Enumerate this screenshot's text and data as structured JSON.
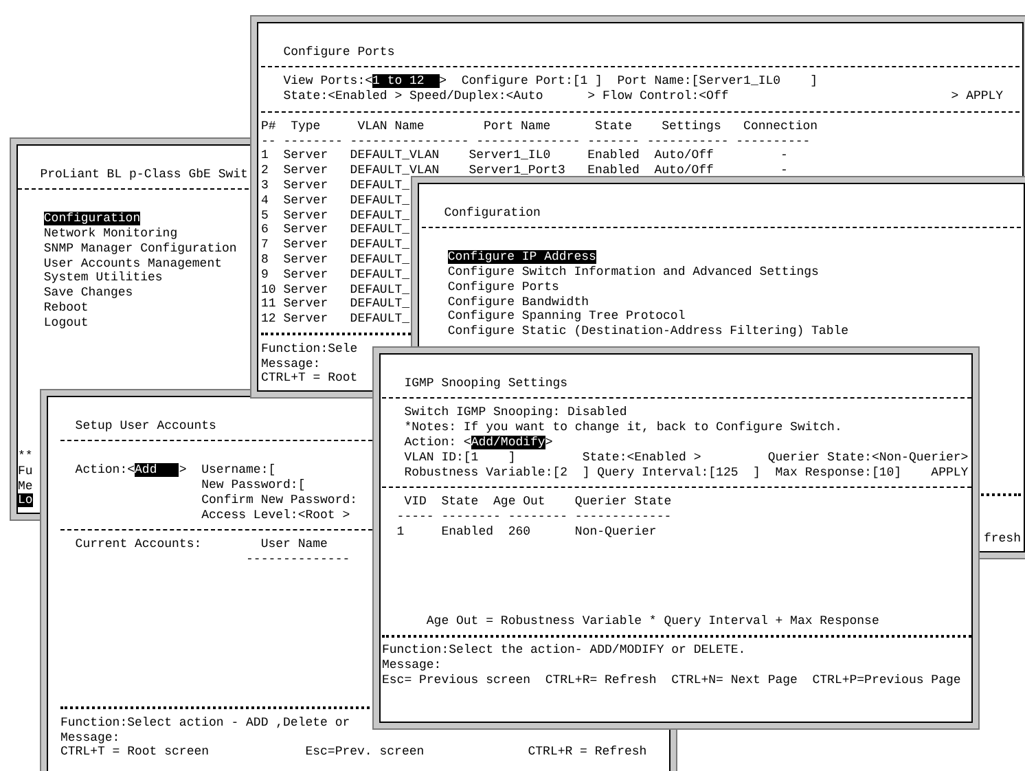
{
  "windows": [
    {
      "lines": [
        {
          "kind": "blank"
        },
        {
          "kind": "text",
          "segments": [
            {
              "text": "   Configure Ports"
            }
          ]
        },
        {
          "kind": "dash_rule"
        },
        {
          "kind": "text",
          "segments": [
            {
              "text": "   View Ports:<"
            },
            {
              "text": "1 to 12  ",
              "selected": true
            },
            {
              "text": ">  Configure Port:[1 ]  Port Name:[Server1_IL0    ]"
            }
          ]
        },
        {
          "kind": "text",
          "segments": [
            {
              "text": "   State:<Enabled > Speed/Duplex:<Auto      > Flow Control:<Off                              > APPLY"
            }
          ]
        },
        {
          "kind": "dash_rule"
        },
        {
          "kind": "text",
          "segments": [
            {
              "text": "P#  Type     VLAN Name        Port Name      State    Settings   Connection"
            }
          ]
        },
        {
          "kind": "text",
          "segments": [
            {
              "text": "-- -------- ---------------- -------------- ------- ----------- ----------"
            }
          ]
        },
        {
          "kind": "text",
          "segments": [
            {
              "text": "1  Server   DEFAULT_VLAN    Server1_IL0     Enabled  Auto/Off         -"
            }
          ]
        },
        {
          "kind": "text",
          "segments": [
            {
              "text": "2  Server   DEFAULT_VLAN    Server1_Port3   Enabled  Auto/Off         -"
            }
          ]
        },
        {
          "kind": "text",
          "segments": [
            {
              "text": "3  Server   DEFAULT_"
            }
          ]
        },
        {
          "kind": "text",
          "segments": [
            {
              "text": "4  Server   DEFAULT_"
            }
          ]
        },
        {
          "kind": "text",
          "segments": [
            {
              "text": "5  Server   DEFAULT_"
            }
          ]
        },
        {
          "kind": "text",
          "segments": [
            {
              "text": "6  Server   DEFAULT_"
            }
          ]
        },
        {
          "kind": "text",
          "segments": [
            {
              "text": "7  Server   DEFAULT_"
            }
          ]
        },
        {
          "kind": "text",
          "segments": [
            {
              "text": "8  Server   DEFAULT_"
            }
          ]
        },
        {
          "kind": "text",
          "segments": [
            {
              "text": "9  Server   DEFAULT_"
            }
          ]
        },
        {
          "kind": "text",
          "segments": [
            {
              "text": "10 Server   DEFAULT_"
            }
          ]
        },
        {
          "kind": "text",
          "segments": [
            {
              "text": "11 Server   DEFAULT_"
            }
          ]
        },
        {
          "kind": "text",
          "segments": [
            {
              "text": "12 Server   DEFAULT_"
            }
          ]
        },
        {
          "kind": "star_rule"
        },
        {
          "kind": "text",
          "segments": [
            {
              "text": "Function:Sele"
            }
          ]
        },
        {
          "kind": "text",
          "segments": [
            {
              "text": "Message:"
            }
          ]
        },
        {
          "kind": "text",
          "segments": [
            {
              "text": "CTRL+T = Root"
            }
          ]
        }
      ]
    },
    {
      "lines": [
        {
          "kind": "blank"
        },
        {
          "kind": "text",
          "segments": [
            {
              "text": "   ProLiant BL p-Class GbE Swit"
            }
          ]
        },
        {
          "kind": "dash_rule"
        },
        {
          "kind": "blank"
        },
        {
          "kind": "menu",
          "text": "Configuration",
          "selected": true
        },
        {
          "kind": "menu",
          "text": "Network Monitoring",
          "selected": false
        },
        {
          "kind": "menu",
          "text": "SNMP Manager Configuration",
          "selected": false
        },
        {
          "kind": "menu",
          "text": "User Accounts Management",
          "selected": false
        },
        {
          "kind": "menu",
          "text": "System Utilities",
          "selected": false
        },
        {
          "kind": "menu",
          "text": "Save Changes",
          "selected": false
        },
        {
          "kind": "menu",
          "text": "Reboot",
          "selected": false
        },
        {
          "kind": "menu",
          "text": "Logout",
          "selected": false
        },
        {
          "kind": "blank"
        },
        {
          "kind": "blank"
        },
        {
          "kind": "blank"
        },
        {
          "kind": "blank"
        },
        {
          "kind": "blank"
        },
        {
          "kind": "blank"
        },
        {
          "kind": "blank"
        },
        {
          "kind": "blank"
        },
        {
          "kind": "text",
          "segments": [
            {
              "text": "**"
            }
          ]
        },
        {
          "kind": "text",
          "segments": [
            {
              "text": "Fu"
            }
          ]
        },
        {
          "kind": "text",
          "segments": [
            {
              "text": "Me"
            }
          ]
        },
        {
          "kind": "text",
          "segments": [
            {
              "text": "Lo",
              "selected": true
            }
          ]
        }
      ]
    },
    {
      "lines": [
        {
          "kind": "blank"
        },
        {
          "kind": "text",
          "segments": [
            {
              "text": "   Configuration"
            }
          ]
        },
        {
          "kind": "dash_rule"
        },
        {
          "kind": "blank"
        },
        {
          "kind": "menu",
          "text": "Configure IP Address",
          "selected": true
        },
        {
          "kind": "menu",
          "text": "Configure Switch Information and Advanced Settings",
          "selected": false
        },
        {
          "kind": "menu",
          "text": "Configure Ports",
          "selected": false
        },
        {
          "kind": "menu",
          "text": "Configure Bandwidth",
          "selected": false
        },
        {
          "kind": "menu",
          "text": "Configure Spanning Tree Protocol",
          "selected": false
        },
        {
          "kind": "menu",
          "text": "Configure Static (Destination-Address Filtering) Table",
          "selected": false
        },
        {
          "kind": "blank"
        },
        {
          "kind": "blank"
        },
        {
          "kind": "blank"
        },
        {
          "kind": "blank"
        },
        {
          "kind": "blank"
        },
        {
          "kind": "blank"
        },
        {
          "kind": "blank"
        },
        {
          "kind": "blank"
        },
        {
          "kind": "blank"
        },
        {
          "kind": "blank"
        },
        {
          "kind": "star_rule"
        },
        {
          "kind": "blank"
        },
        {
          "kind": "blank"
        },
        {
          "kind": "tail",
          "text": "fresh"
        }
      ]
    },
    {
      "lines": [
        {
          "kind": "blank"
        },
        {
          "kind": "text",
          "segments": [
            {
              "text": "   IGMP Snooping Settings"
            }
          ]
        },
        {
          "kind": "dash_rule"
        },
        {
          "kind": "text",
          "segments": [
            {
              "text": "   Switch IGMP Snooping: Disabled"
            }
          ]
        },
        {
          "kind": "text",
          "segments": [
            {
              "text": "   *Notes: If you want to change it, back to Configure Switch."
            }
          ]
        },
        {
          "kind": "text",
          "segments": [
            {
              "text": "   Action: <"
            },
            {
              "text": "Add/Modify",
              "selected": true
            },
            {
              "text": ">"
            }
          ]
        },
        {
          "kind": "text",
          "segments": [
            {
              "text": "   VLAN ID:[1    ]         State:<Enabled >         Querier State:<Non-Querier>"
            }
          ]
        },
        {
          "kind": "text",
          "segments": [
            {
              "text": "   Robustness Variable:[2  ] Query Interval:[125  ]  Max Response:[10]    APPLY"
            }
          ]
        },
        {
          "kind": "dash_rule"
        },
        {
          "kind": "text",
          "segments": [
            {
              "text": "   VID  State  Age Out    Querier State"
            }
          ]
        },
        {
          "kind": "text",
          "segments": [
            {
              "text": "  ----- -------- -------- -------------"
            }
          ]
        },
        {
          "kind": "text",
          "segments": [
            {
              "text": "  1     Enabled  260      Non-Querier"
            }
          ]
        },
        {
          "kind": "blank"
        },
        {
          "kind": "blank"
        },
        {
          "kind": "blank"
        },
        {
          "kind": "blank"
        },
        {
          "kind": "blank"
        },
        {
          "kind": "text",
          "segments": [
            {
              "text": "      Age Out = Robustness Variable * Query Interval + Max Response"
            }
          ]
        },
        {
          "kind": "star_rule"
        },
        {
          "kind": "text",
          "segments": [
            {
              "text": "Function:Select the action- ADD/MODIFY or DELETE."
            }
          ]
        },
        {
          "kind": "text",
          "segments": [
            {
              "text": "Message:"
            }
          ]
        },
        {
          "kind": "text",
          "segments": [
            {
              "text": "Esc= Previous screen  CTRL+R= Refresh  CTRL+N= Next Page  CTRL+P=Previous Page"
            }
          ]
        },
        {
          "kind": "blank"
        },
        {
          "kind": "blank"
        }
      ]
    },
    {
      "lines": [
        {
          "kind": "blank"
        },
        {
          "kind": "text",
          "segments": [
            {
              "text": "  Setup User Accounts"
            }
          ]
        },
        {
          "kind": "dash_rule"
        },
        {
          "kind": "blank"
        },
        {
          "kind": "text",
          "segments": [
            {
              "text": "  Action:<"
            },
            {
              "text": "Add   ",
              "selected": true
            },
            {
              "text": ">  Username:["
            }
          ]
        },
        {
          "kind": "text",
          "segments": [
            {
              "text": "                   New Password:["
            }
          ]
        },
        {
          "kind": "text",
          "segments": [
            {
              "text": "                   Confirm New Password:"
            }
          ]
        },
        {
          "kind": "text",
          "segments": [
            {
              "text": "                   Access Level:<Root >"
            }
          ]
        },
        {
          "kind": "dash_rule"
        },
        {
          "kind": "text",
          "segments": [
            {
              "text": "  Current Accounts:        User Name"
            }
          ]
        },
        {
          "kind": "text",
          "segments": [
            {
              "text": "                         --------------"
            }
          ]
        },
        {
          "kind": "blank"
        },
        {
          "kind": "blank"
        },
        {
          "kind": "blank"
        },
        {
          "kind": "blank"
        },
        {
          "kind": "blank"
        },
        {
          "kind": "blank"
        },
        {
          "kind": "blank"
        },
        {
          "kind": "blank"
        },
        {
          "kind": "blank"
        },
        {
          "kind": "star_rule"
        },
        {
          "kind": "text",
          "segments": [
            {
              "text": "Function:Select action - ADD ,Delete or"
            }
          ]
        },
        {
          "kind": "text",
          "segments": [
            {
              "text": "Message:"
            }
          ]
        },
        {
          "kind": "text",
          "segments": [
            {
              "text": "CTRL+T = Root screen             Esc=Prev. screen              CTRL+R = Refresh"
            }
          ]
        },
        {
          "kind": "blank"
        }
      ]
    }
  ]
}
